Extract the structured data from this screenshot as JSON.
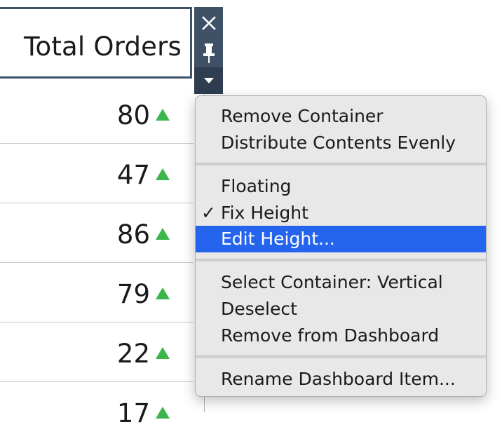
{
  "header": {
    "title": "Total Orders"
  },
  "rows": [
    {
      "value": "80",
      "trend": "up"
    },
    {
      "value": "47",
      "trend": "up"
    },
    {
      "value": "86",
      "trend": "up"
    },
    {
      "value": "79",
      "trend": "up"
    },
    {
      "value": "22",
      "trend": "up"
    },
    {
      "value": "17",
      "trend": "up"
    }
  ],
  "toolbar": {
    "close_icon": "close-icon",
    "pin_icon": "pin-icon",
    "more_icon": "dropdown-arrow-icon"
  },
  "menu": {
    "remove_container": "Remove Container",
    "distribute_evenly": "Distribute Contents Evenly",
    "floating": "Floating",
    "fix_height": "Fix Height",
    "fix_height_checked": true,
    "edit_height": "Edit Height...",
    "select_container": "Select Container: Vertical",
    "deselect": "Deselect",
    "remove_from_dashboard": "Remove from Dashboard",
    "rename_item": "Rename Dashboard Item..."
  },
  "colors": {
    "accent": "#2565ee",
    "toolbar": "#3f5167",
    "trend_up": "#3cb54a"
  }
}
